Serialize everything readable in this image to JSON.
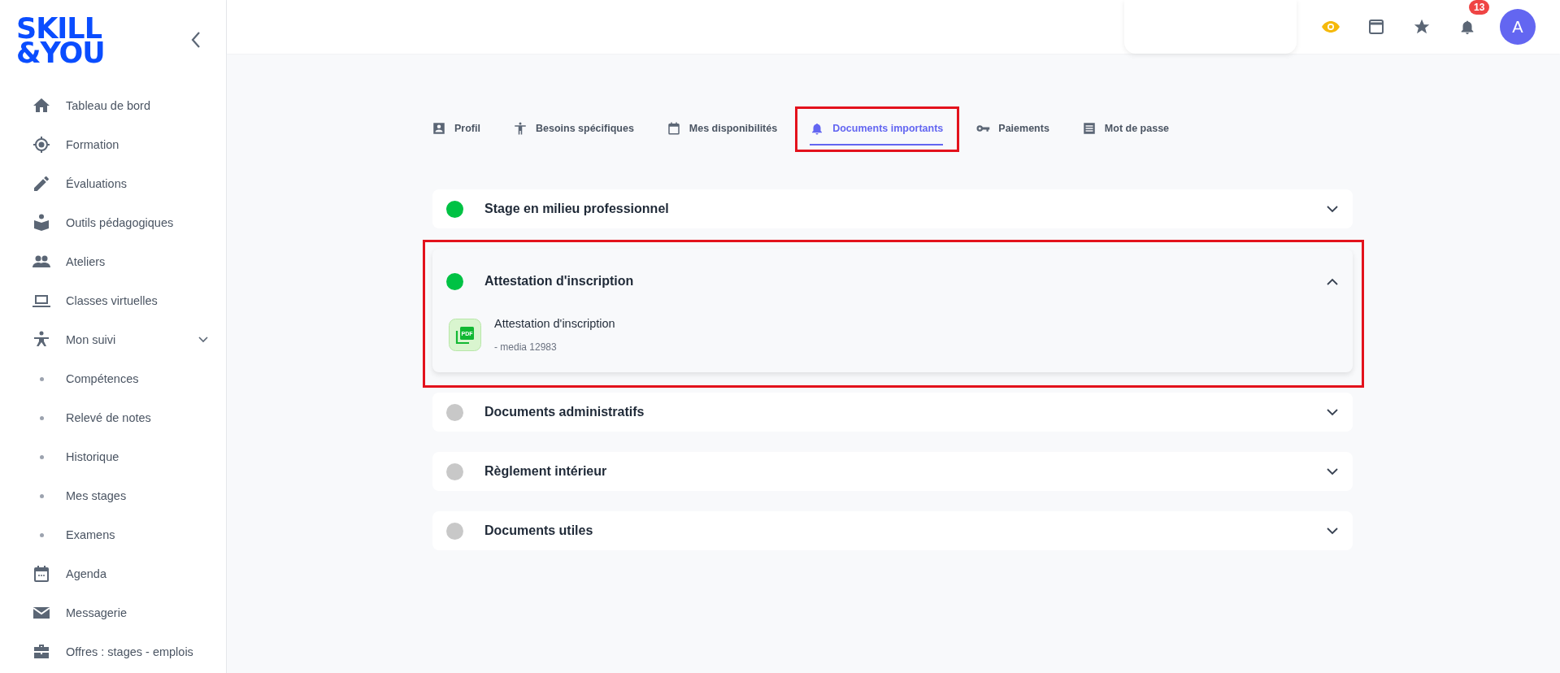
{
  "logo": {
    "line1": "SKILL",
    "line2": "&YOU"
  },
  "sidebar": {
    "items": [
      {
        "label": "Tableau de bord",
        "kind": "link"
      },
      {
        "label": "Formation",
        "kind": "link"
      },
      {
        "label": "Évaluations",
        "kind": "link"
      },
      {
        "label": "Outils pédagogiques",
        "kind": "link"
      },
      {
        "label": "Ateliers",
        "kind": "link"
      },
      {
        "label": "Classes virtuelles",
        "kind": "link"
      },
      {
        "label": "Mon suivi",
        "kind": "group",
        "expanded": true,
        "children": [
          {
            "label": "Compétences"
          },
          {
            "label": "Relevé de notes"
          },
          {
            "label": "Historique"
          },
          {
            "label": "Mes stages"
          },
          {
            "label": "Examens"
          }
        ]
      },
      {
        "label": "Agenda",
        "kind": "link"
      },
      {
        "label": "Messagerie",
        "kind": "link"
      },
      {
        "label": "Offres : stages - emplois",
        "kind": "link"
      }
    ]
  },
  "topbar": {
    "notification_count": "13",
    "avatar_initial": "A"
  },
  "tabs": [
    {
      "label": "Profil",
      "selected": false,
      "highlighted": false
    },
    {
      "label": "Besoins spécifiques",
      "selected": false,
      "highlighted": false
    },
    {
      "label": "Mes disponibilités",
      "selected": false,
      "highlighted": false
    },
    {
      "label": "Documents importants",
      "selected": true,
      "highlighted": true
    },
    {
      "label": "Paiements",
      "selected": false,
      "highlighted": false
    },
    {
      "label": "Mot de passe",
      "selected": false,
      "highlighted": false
    }
  ],
  "sections": [
    {
      "title": "Stage en milieu professionnel",
      "color": "#00c244",
      "expanded": false,
      "highlighted": false
    },
    {
      "title": "Attestation d'inscription",
      "color": "#00c244",
      "expanded": true,
      "highlighted": true,
      "files": [
        {
          "name": "Attestation d'inscription",
          "meta": "- media 12983",
          "badge": "PDF"
        }
      ]
    },
    {
      "title": "Documents administratifs",
      "color": "#c8c8c8",
      "expanded": false,
      "highlighted": false
    },
    {
      "title": "Règlement intérieur",
      "color": "#c8c8c8",
      "expanded": false,
      "highlighted": false
    },
    {
      "title": "Documents utiles",
      "color": "#c8c8c8",
      "expanded": false,
      "highlighted": false
    }
  ]
}
